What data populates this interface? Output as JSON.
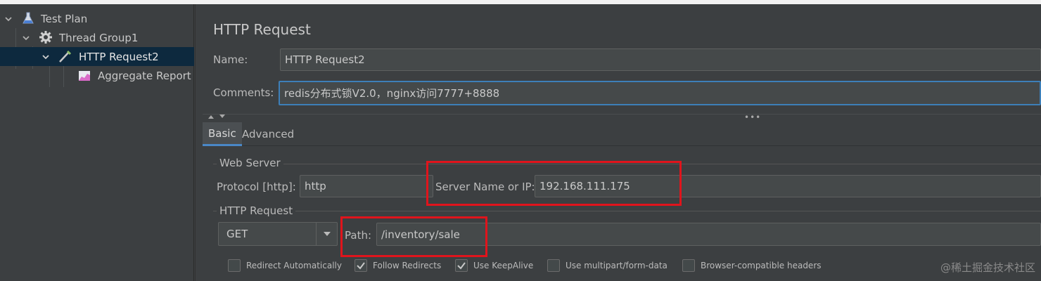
{
  "tree": {
    "items": [
      {
        "label": "Test Plan",
        "icon": "flask-icon",
        "expanded": true
      },
      {
        "label": "Thread Group1",
        "icon": "gear-icon",
        "expanded": true
      },
      {
        "label": "HTTP Request2",
        "icon": "pipette-icon",
        "expanded": true,
        "selected": true
      },
      {
        "label": "Aggregate Report",
        "icon": "chart-icon"
      }
    ]
  },
  "panel": {
    "title": "HTTP Request",
    "name_label": "Name:",
    "name_value": "HTTP Request2",
    "comments_label": "Comments:",
    "comments_value": "redis分布式锁V2.0，nginx访问7777+8888"
  },
  "tabs": [
    "Basic",
    "Advanced"
  ],
  "web_server": {
    "group_title": "Web Server",
    "protocol_label": "Protocol [http]:",
    "protocol_value": "http",
    "server_label": "Server Name or IP:",
    "server_value": "192.168.111.175"
  },
  "http_request": {
    "group_title": "HTTP Request",
    "method": "GET",
    "path_label": "Path:",
    "path_value": "/inventory/sale"
  },
  "options": [
    {
      "label": "Redirect Automatically",
      "checked": false
    },
    {
      "label": "Follow Redirects",
      "checked": true
    },
    {
      "label": "Use KeepAlive",
      "checked": true
    },
    {
      "label": "Use multipart/form-data",
      "checked": false
    },
    {
      "label": "Browser-compatible headers",
      "checked": false
    }
  ],
  "watermark": "@稀土掘金技术社区",
  "colors": {
    "highlight": "#e0141c",
    "selection": "#0d293e",
    "focus": "#3d7fb8"
  }
}
